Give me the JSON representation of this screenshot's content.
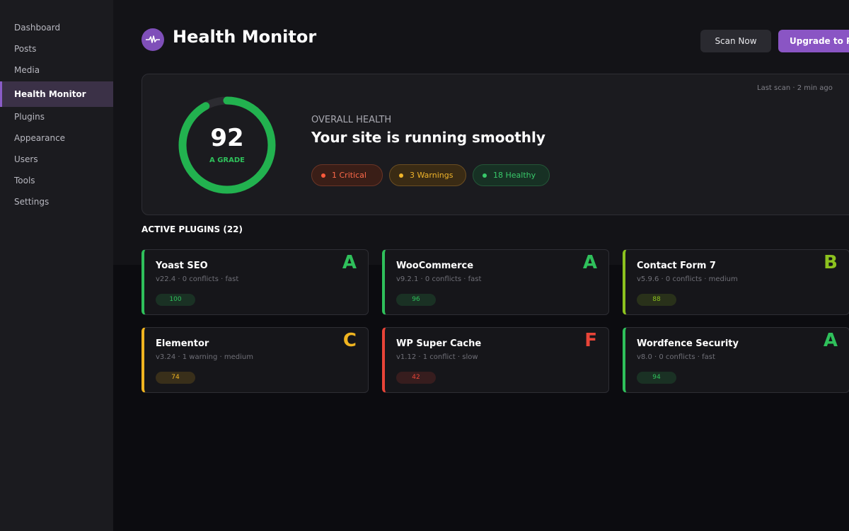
{
  "sidebar": {
    "items": [
      {
        "label": "Dashboard"
      },
      {
        "label": "Posts"
      },
      {
        "label": "Media"
      },
      {
        "label": "Health Monitor",
        "active": true
      },
      {
        "label": "Plugins"
      },
      {
        "label": "Appearance"
      },
      {
        "label": "Users"
      },
      {
        "label": "Tools"
      },
      {
        "label": "Settings"
      }
    ]
  },
  "header": {
    "title": "Health Monitor",
    "icon": "pulse-icon",
    "scan_label": "Scan Now",
    "upgrade_label": "Upgrade to Pro"
  },
  "health": {
    "last_scan": "Last scan · 2 min ago",
    "score": "92",
    "score_fraction": 0.92,
    "grade": "A GRADE",
    "overall_label": "OVERALL HEALTH",
    "headline": "Your site is running smoothly",
    "pills": {
      "critical": "1 Critical",
      "warnings": "3 Warnings",
      "healthy": "18 Healthy"
    }
  },
  "plugins": {
    "title": "ACTIVE PLUGINS (22)",
    "items": [
      {
        "name": "Yoast SEO",
        "meta": "v22.4 · 0 conflicts · fast",
        "score": "100",
        "grade": "A",
        "color": "#2fc05b"
      },
      {
        "name": "WooCommerce",
        "meta": "v9.2.1 · 0 conflicts · fast",
        "score": "96",
        "grade": "A",
        "color": "#2fc05b"
      },
      {
        "name": "Contact Form 7",
        "meta": "v5.9.6 · 0 conflicts · medium",
        "score": "88",
        "grade": "B",
        "color": "#8cc21f"
      },
      {
        "name": "Elementor",
        "meta": "v3.24 · 1 warning · medium",
        "score": "74",
        "grade": "C",
        "color": "#f0b420"
      },
      {
        "name": "WP Super Cache",
        "meta": "v1.12 · 1 conflict · slow",
        "score": "42",
        "grade": "F",
        "color": "#e84438"
      },
      {
        "name": "Wordfence Security",
        "meta": "v8.0 · 0 conflicts · fast",
        "score": "94",
        "grade": "A",
        "color": "#2fc05b"
      }
    ]
  },
  "colors": {
    "accent": "#8a55c4",
    "good": "#2fc05b",
    "ok": "#8cc21f",
    "warn": "#f0b420",
    "bad": "#e84438"
  }
}
